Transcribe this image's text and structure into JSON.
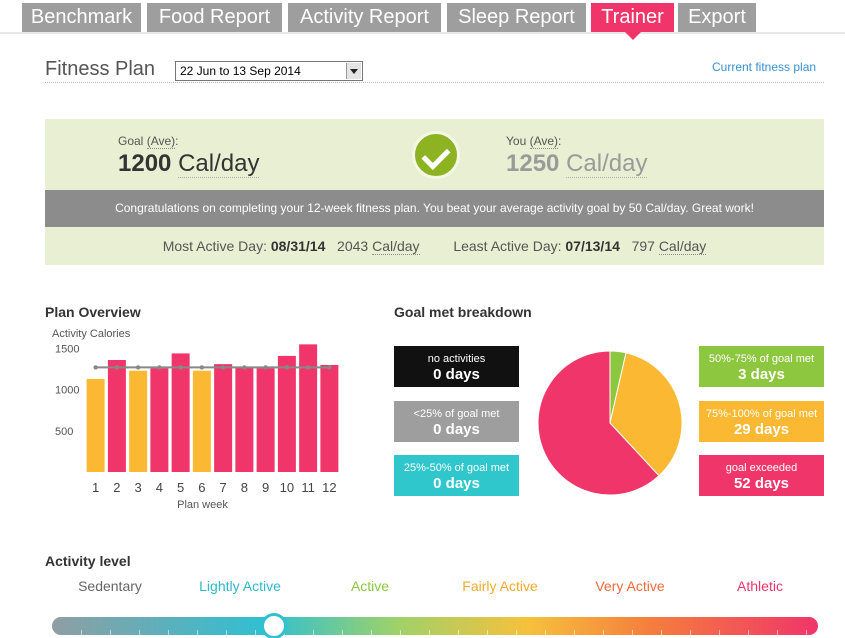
{
  "tabs": [
    {
      "label": "Benchmark",
      "active": false
    },
    {
      "label": "Food Report",
      "active": false
    },
    {
      "label": "Activity Report",
      "active": false
    },
    {
      "label": "Sleep Report",
      "active": false
    },
    {
      "label": "Trainer",
      "active": true
    },
    {
      "label": "Export",
      "active": false
    }
  ],
  "header": {
    "title": "Fitness Plan",
    "date_range": "22 Jun to 13 Sep 2014",
    "current_plan_link": "Current fitness plan"
  },
  "summary": {
    "goal_label": "Goal",
    "goal_ave": "(Ave)",
    "goal_value": "1200",
    "unit": "Cal/day",
    "you_label": "You",
    "you_ave": "(Ave)",
    "you_value": "1250",
    "congrats": "Congratulations on completing your 12-week fitness plan. You beat your average activity goal by 50 Cal/day. Great work!",
    "most_active_label": "Most Active Day:",
    "most_active_date": "08/31/14",
    "most_active_value": "2043",
    "least_active_label": "Least Active Day:",
    "least_active_date": "07/13/14",
    "least_active_value": "797",
    "colors": {
      "panel": "#e9efd2",
      "check": "#8db323",
      "banner": "#8c8c8c"
    }
  },
  "plan_overview": {
    "title": "Plan Overview"
  },
  "chart_data": {
    "type": "bar",
    "ylabel": "Activity Calories",
    "xlabel": "Plan week",
    "categories": [
      "1",
      "2",
      "3",
      "4",
      "5",
      "6",
      "7",
      "8",
      "9",
      "10",
      "11",
      "12"
    ],
    "values": [
      1130,
      1360,
      1230,
      1260,
      1440,
      1230,
      1310,
      1270,
      1260,
      1410,
      1550,
      1300
    ],
    "bar_colors": [
      "#fbb933",
      "#f0356a",
      "#fbb933",
      "#f0356a",
      "#f0356a",
      "#fbb933",
      "#f0356a",
      "#f0356a",
      "#f0356a",
      "#f0356a",
      "#f0356a",
      "#f0356a"
    ],
    "goal_line": 1270,
    "yticks": [
      500,
      1000,
      1500
    ],
    "ylim": [
      0,
      1700
    ],
    "grid": false
  },
  "breakdown": {
    "title": "Goal met breakdown",
    "tiles": [
      {
        "label": "no activities",
        "value": "0 days",
        "color": "#111111"
      },
      {
        "label": "<25% of goal met",
        "value": "0 days",
        "color": "#9e9e9e"
      },
      {
        "label": "25%-50% of goal met",
        "value": "0 days",
        "color": "#2fc6cc"
      },
      {
        "label": "50%-75% of goal met",
        "value": "3 days",
        "color": "#8dc63f"
      },
      {
        "label": "75%-100% of goal met",
        "value": "29 days",
        "color": "#fbb933"
      },
      {
        "label": "goal exceeded",
        "value": "52 days",
        "color": "#f0356a"
      }
    ],
    "pie": [
      {
        "name": "50%-75% of goal met",
        "value": 3,
        "color": "#8dc63f"
      },
      {
        "name": "75%-100% of goal met",
        "value": 29,
        "color": "#fbb933"
      },
      {
        "name": "goal exceeded",
        "value": 52,
        "color": "#f0356a"
      }
    ]
  },
  "activity_level": {
    "title": "Activity level",
    "levels": [
      {
        "label": "Sedentary",
        "color": "#666666"
      },
      {
        "label": "Lightly Active",
        "color": "#2fb7cc"
      },
      {
        "label": "Active",
        "color": "#8dc63f"
      },
      {
        "label": "Fairly Active",
        "color": "#f2a92e"
      },
      {
        "label": "Very Active",
        "color": "#f06a3a"
      },
      {
        "label": "Athletic",
        "color": "#f0356a"
      }
    ],
    "slider_position": 0.29
  }
}
